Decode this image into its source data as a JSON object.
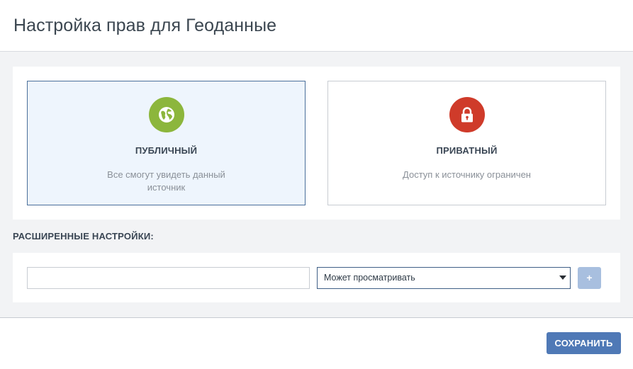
{
  "dialog": {
    "title": "Настройка прав для Геоданные"
  },
  "access": {
    "options": [
      {
        "title": "ПУБЛИЧНЫЙ",
        "description": "Все смогут увидеть данный источник",
        "icon": "globe-icon",
        "color": "#8cb63c",
        "selected": true
      },
      {
        "title": "ПРИВАТНЫЙ",
        "description": "Доступ к источнику ограничен",
        "icon": "lock-icon",
        "color": "#cf3b2a",
        "selected": false
      }
    ]
  },
  "advanced": {
    "label": "РАСШИРЕННЫЕ НАСТРОЙКИ:",
    "user_input_value": "",
    "permission_selected": "Может просматривать",
    "add_label": "+"
  },
  "footer": {
    "save_label": "СОХРАНИТЬ",
    "save_color": "#4f79b6"
  }
}
